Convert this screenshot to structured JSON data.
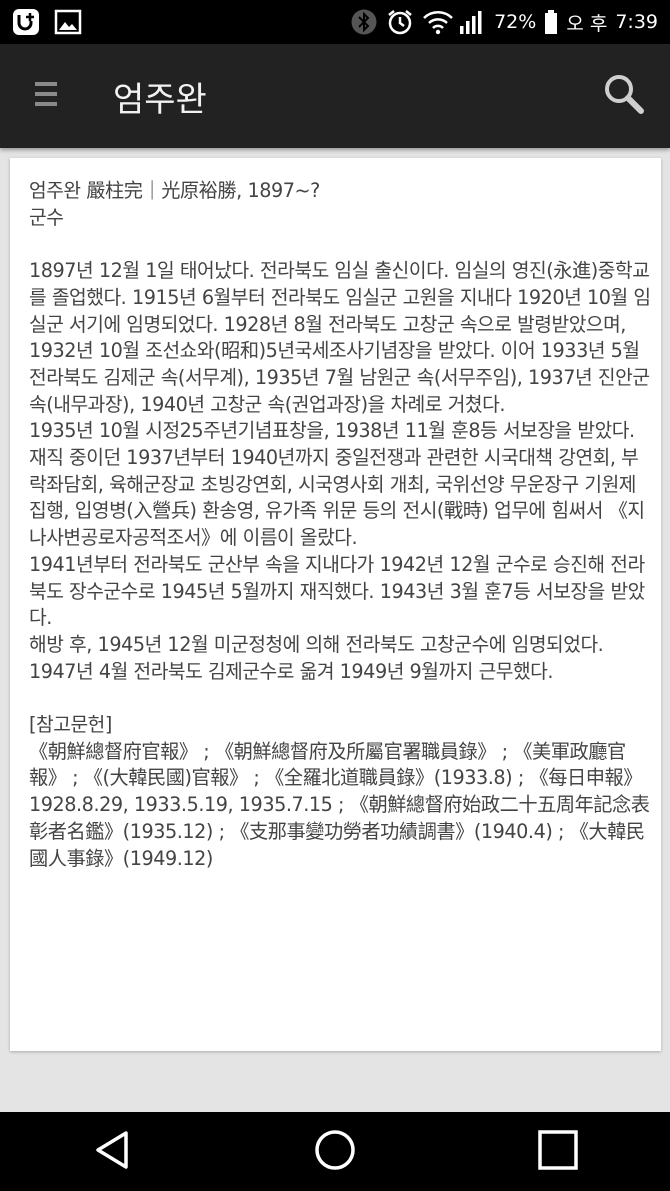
{
  "status_bar": {
    "battery": "72%",
    "ampm": "오 후",
    "time": "7:39",
    "icons": [
      "u-plus-icon",
      "image-icon",
      "bluetooth-icon",
      "alarm-icon",
      "wifi-icon",
      "signal-icon",
      "battery-icon"
    ]
  },
  "app_bar": {
    "title": "엄주완",
    "menu_icon": "menu-icon",
    "search_icon": "search-icon"
  },
  "article": {
    "header": "엄주완 嚴柱完｜光原裕勝, 1897~?",
    "subtitle": "군수",
    "body": [
      "1897년 12월 1일 태어났다. 전라북도 임실 출신이다. 임실의 영진(永進)중학교를 졸업했다. 1915년 6월부터 전라북도 임실군 고원을 지내다 1920년 10월 임실군 서기에 임명되었다. 1928년 8월 전라북도 고창군 속으로 발령받았으며, 1932년 10월 조선쇼와(昭和)5년국세조사기념장을 받았다. 이어 1933년 5월 전라북도 김제군 속(서무계), 1935년 7월 남원군 속(서무주임), 1937년 진안군 속(내무과장), 1940년 고창군 속(권업과장)을 차례로 거쳤다.",
      "1935년 10월 시정25주년기념표창을, 1938년 11월 훈8등 서보장을 받았다. 재직 중이던 1937년부터 1940년까지 중일전쟁과 관련한 시국대책 강연회, 부락좌담회, 육해군장교 초빙강연회, 시국영사회 개최, 국위선양 무운장구 기원제 집행, 입영병(入營兵) 환송영, 유가족 위문 등의 전시(戰時) 업무에 힘써서 《지나사변공로자공적조서》에 이름이 올랐다.",
      "1941년부터 전라북도 군산부 속을 지내다가 1942년 12월 군수로 승진해 전라북도 장수군수로 1945년 5월까지 재직했다. 1943년 3월 훈7등 서보장을 받았다.",
      "해방 후, 1945년 12월 미군정청에 의해 전라북도 고창군수에 임명되었다. 1947년 4월 전라북도 김제군수로 옮겨 1949년 9월까지 근무했다."
    ],
    "refs_title": "[참고문헌]",
    "refs": "《朝鮮總督府官報》 ; 《朝鮮總督府及所屬官署職員錄》 ; 《美軍政廳官報》 ; 《(大韓民國)官報》 ; 《全羅北道職員錄》(1933.8) ; 《每日申報》 1928.8.29, 1933.5.19, 1935.7.15 ; 《朝鮮總督府始政二十五周年記念表彰者名鑑》(1935.12) ; 《支那事變功勞者功績調書》(1940.4) ; 《大韓民國人事錄》(1949.12)"
  },
  "nav_bar": {
    "icons": [
      "back-icon",
      "home-icon",
      "recents-icon"
    ]
  }
}
